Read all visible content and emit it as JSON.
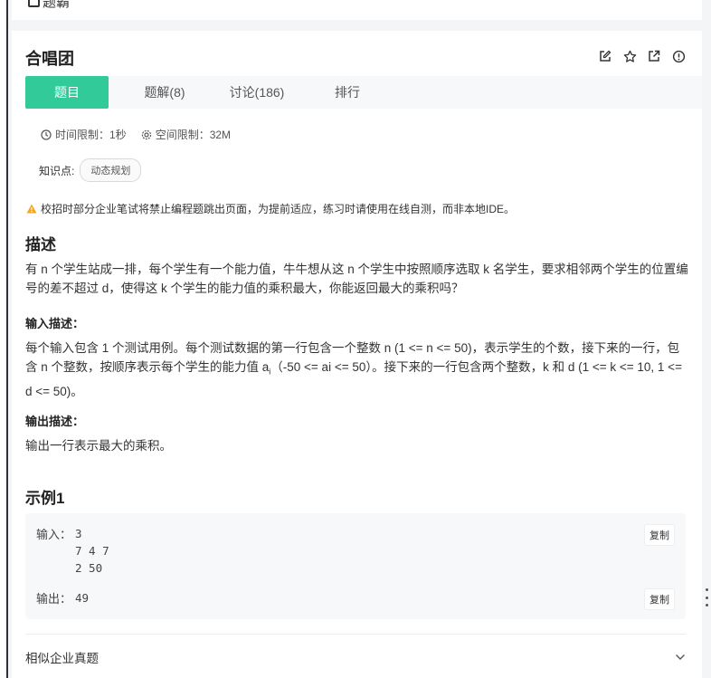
{
  "breadcrumb": {
    "label": "题霸"
  },
  "problem": {
    "title": "合唱团",
    "tabs": [
      {
        "label": "题目",
        "active": true
      },
      {
        "label": "题解(8)"
      },
      {
        "label": "讨论(186)"
      },
      {
        "label": "排行"
      }
    ],
    "time_limit": "时间限制：1秒",
    "space_limit": "空间限制：32M",
    "knowledge_label": "知识点:",
    "knowledge_tag": "动态规划",
    "warning": "校招时部分企业笔试将禁止编程题跳出页面，为提前适应，练习时请使用在线自测，而非本地IDE。",
    "description_heading": "描述",
    "description": "有 n 个学生站成一排，每个学生有一个能力值，牛牛想从这 n 个学生中按照顺序选取 k 名学生，要求相邻两个学生的位置编号的差不超过 d，使得这 k 个学生的能力值的乘积最大，你能返回最大的乘积吗？",
    "input_heading": "输入描述：",
    "input_desc_part1": "每个输入包含 1 个测试用例。每个测试数据的第一行包含一个整数 n (1 <= n <= 50)，表示学生的个数，接下来的一行，包含 n 个整数，按顺序表示每个学生的能力值 a",
    "input_desc_sub": "i",
    "input_desc_part2": "（-50 <= ai <= 50）。接下来的一行包含两个整数，k 和 d (1 <= k <= 10, 1 <= d <= 50)。",
    "output_heading": "输出描述：",
    "output_desc": "输出一行表示最大的乘积。",
    "example_heading": "示例1",
    "example": {
      "input_label": "输入：",
      "input_lines": [
        "3",
        "7 4 7",
        "2 50"
      ],
      "output_label": "输出：",
      "output_lines": [
        "49"
      ],
      "copy_label": "复制"
    },
    "similar_label": "相似企业真题"
  },
  "colors": {
    "accent": "#32ca99",
    "warning": "#f5a623"
  }
}
